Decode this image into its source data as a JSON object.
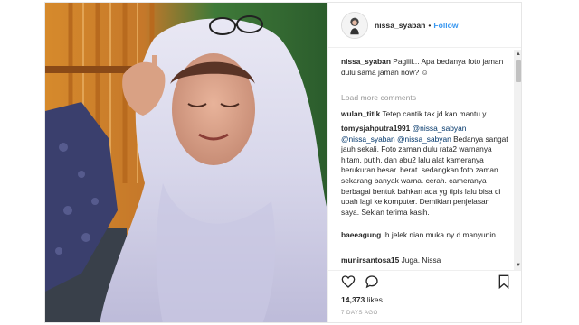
{
  "post": {
    "username": "nissa_syaban",
    "separator": "•",
    "follow_label": "Follow",
    "caption": {
      "username": "nissa_syaban",
      "text": "Pagiiii... Apa bedanya foto jaman dulu sama jaman now? ☺"
    },
    "load_more_label": "Load more comments",
    "comments": [
      {
        "user": "wulan_titik",
        "text": "Tetep cantik tak jd kan mantu y"
      },
      {
        "user": "tomysjahputra1991",
        "text": "@nissa_sabyan @nissa_syaban @nissa_sabyan Bedanya sangat jauh sekali. Foto zaman dulu rata2 warnanya hitam. putih. dan abu2 lalu alat kameranya berukuran besar. berat. sedangkan foto zaman sekarang banyak warna. cerah. cameranya berbagai bentuk bahkan ada yg tipis lalu bisa di ubah lagi ke komputer. Demikian penjelasan saya. Sekian terima kasih."
      },
      {
        "user": "baeeagung",
        "text": "Ih jelek nian muka ny d manyunin"
      },
      {
        "user": "munirsantosa15",
        "text": "Juga. Nissa"
      }
    ],
    "likes_count": "14,373",
    "likes_label": "likes",
    "timestamp": "7 DAYS AGO"
  },
  "icons": {
    "like": "heart-icon",
    "comment": "comment-icon",
    "bookmark": "bookmark-icon",
    "scroll_up": "▲",
    "scroll_down": "▼"
  },
  "colors": {
    "follow": "#3897f0",
    "mention": "#003569",
    "muted": "#999999"
  }
}
